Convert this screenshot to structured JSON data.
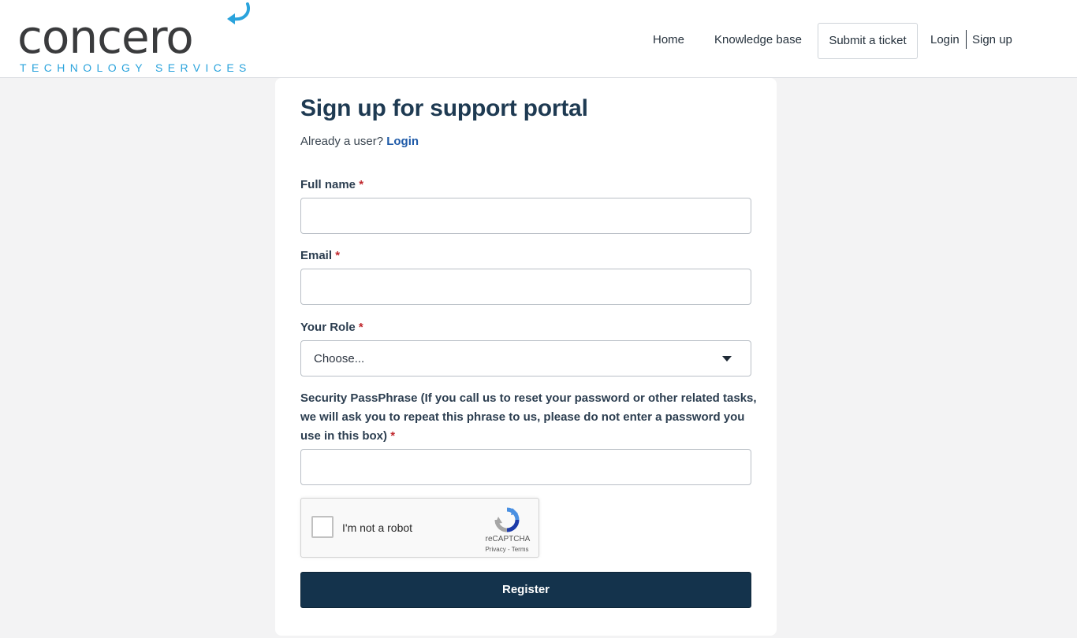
{
  "brand": {
    "wordmark": "concero",
    "tagline": "TECHNOLOGY SERVICES",
    "accent_color": "#2aa3dc"
  },
  "nav": {
    "home": "Home",
    "knowledge_base": "Knowledge base",
    "submit_ticket": "Submit a ticket",
    "login": "Login",
    "signup": "Sign up"
  },
  "form": {
    "title": "Sign up for support portal",
    "already_user": "Already a user?",
    "login_link": "Login",
    "full_name_label": "Full name",
    "email_label": "Email",
    "role_label": "Your Role",
    "role_selected": "Choose...",
    "passphrase_label": "Security PassPhrase (If you call us to reset your password or other related tasks, we will ask you to repeat this phrase to us, please do not enter a password you use in this box)",
    "required_mark": "*",
    "full_name_value": "",
    "email_value": "",
    "passphrase_value": "",
    "register_label": "Register"
  },
  "captcha": {
    "label": "I'm not a robot",
    "brand": "reCAPTCHA",
    "links": "Privacy - Terms",
    "checked": false
  },
  "colors": {
    "primary_button": "#14334c",
    "required": "#c0272d",
    "link": "#1e5aa8",
    "page_background": "#f3f3f4"
  }
}
